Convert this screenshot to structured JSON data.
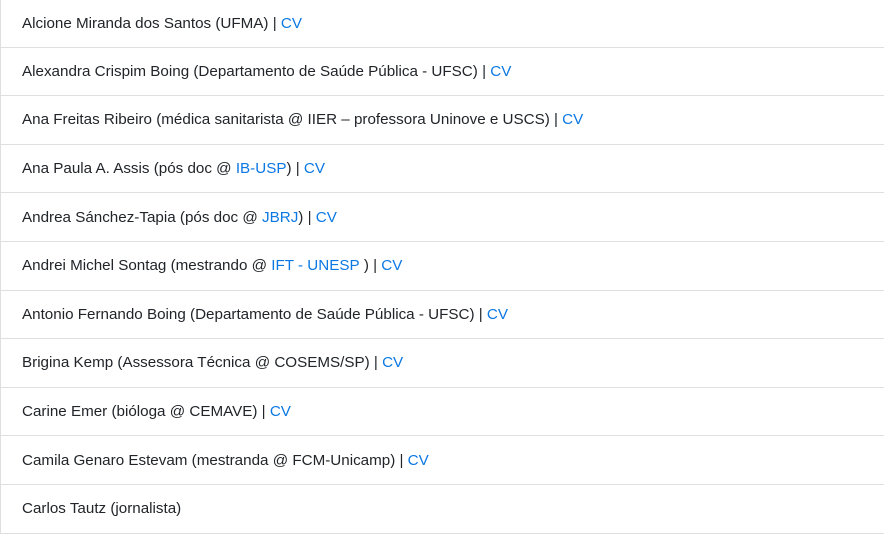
{
  "people": [
    {
      "name": "Alcione Miranda dos Santos (UFMA)",
      "sep": " | ",
      "cv": "CV"
    },
    {
      "name": "Alexandra Crispim Boing (Departamento de Saúde Pública - UFSC)",
      "sep": " | ",
      "cv": "CV"
    },
    {
      "name": "Ana Freitas Ribeiro (médica sanitarista @ IIER – professora Uninove e USCS)",
      "sep": " | ",
      "cv": "CV"
    },
    {
      "pre": "Ana Paula A. Assis (pós doc @ ",
      "org": "IB-USP",
      "post": ") | ",
      "cv": "CV"
    },
    {
      "pre": "Andrea Sánchez-Tapia (pós doc @ ",
      "org": "JBRJ",
      "post": ") | ",
      "cv": "CV"
    },
    {
      "pre": "Andrei Michel Sontag (mestrando @ ",
      "org": "IFT - UNESP",
      "post": " ) | ",
      "cv": "CV"
    },
    {
      "name": "Antonio Fernando Boing (Departamento de Saúde Pública - UFSC)",
      "sep": " | ",
      "cv": "CV"
    },
    {
      "name": "Brigina Kemp (Assessora Técnica @ COSEMS/SP)",
      "sep": " | ",
      "cv": "CV"
    },
    {
      "name": "Carine Emer (bióloga @ CEMAVE)",
      "sep": " | ",
      "cv": "CV"
    },
    {
      "name": "Camila Genaro Estevam (mestranda @ FCM-Unicamp)",
      "sep": " | ",
      "cv": "CV"
    },
    {
      "name": "Carlos Tautz (jornalista)"
    }
  ],
  "colors": {
    "link": "#0b78e3",
    "text": "#212529",
    "border": "#dfdfdf"
  }
}
